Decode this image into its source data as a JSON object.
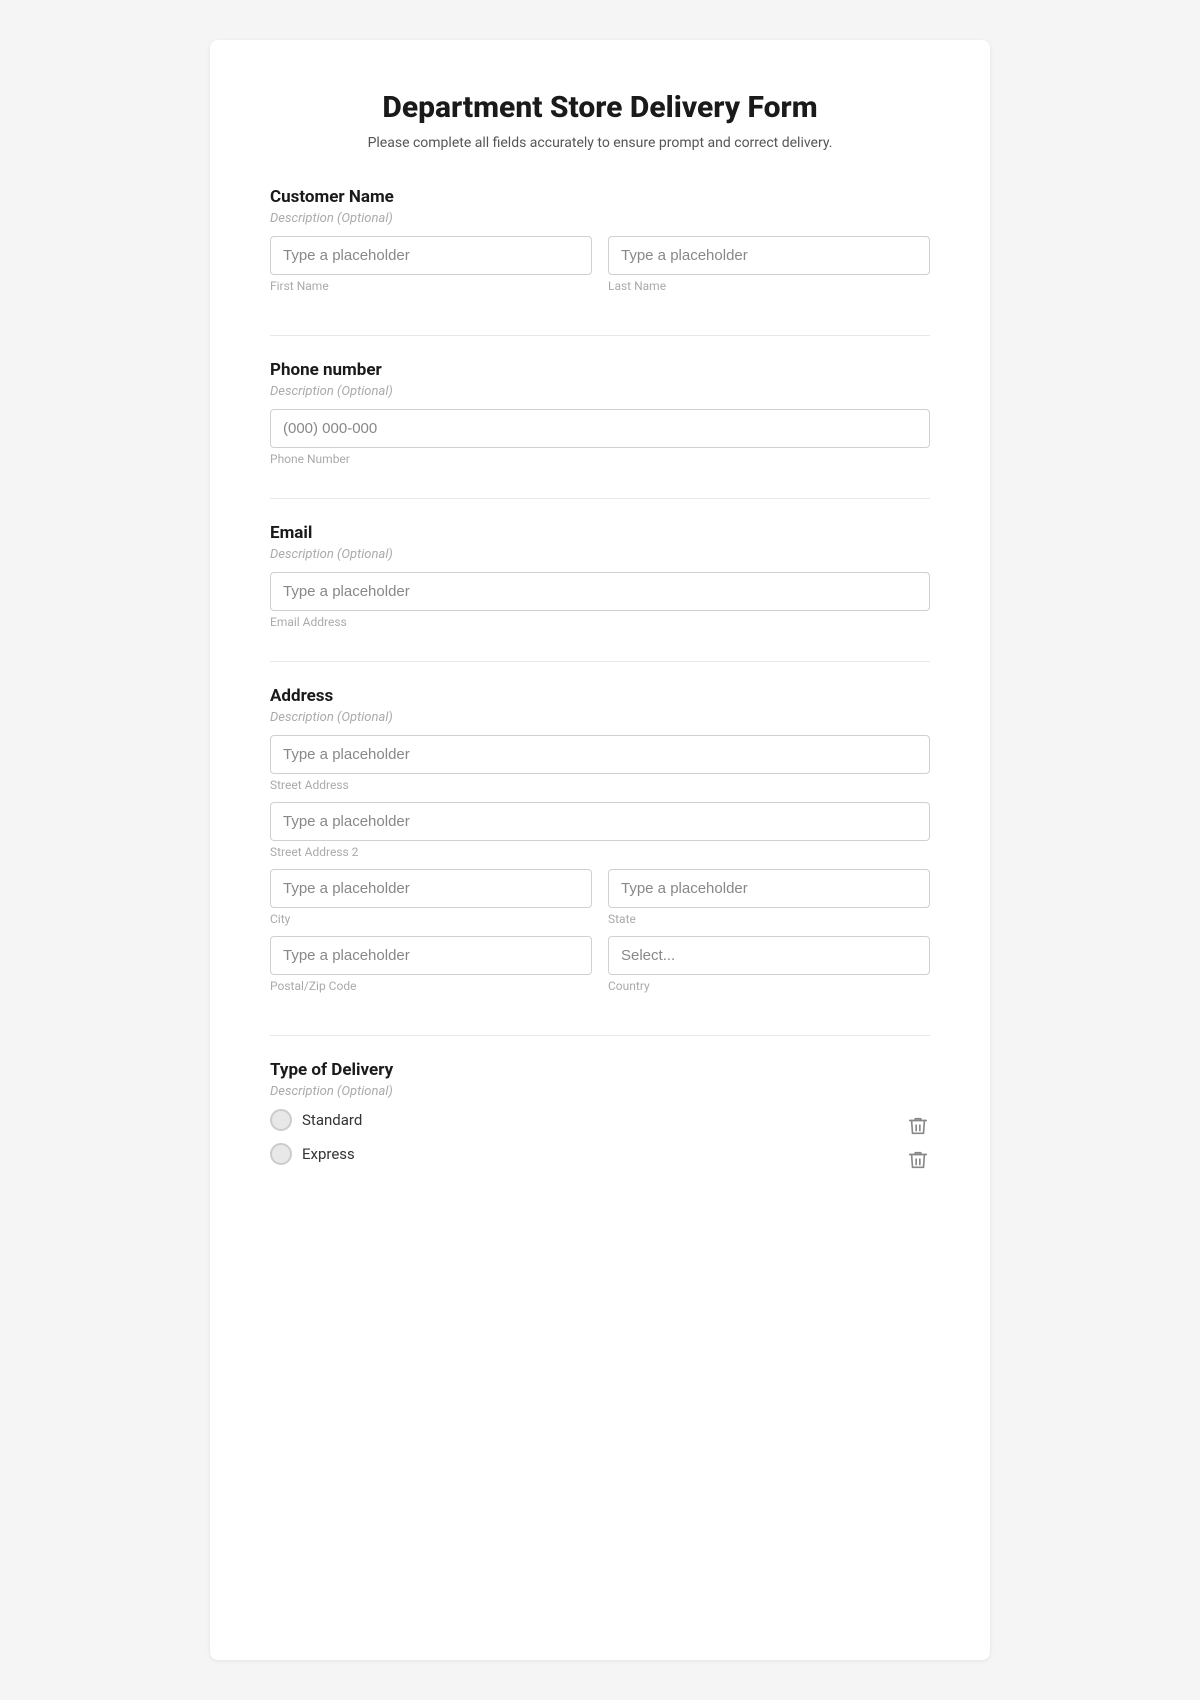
{
  "form": {
    "title": "Department Store Delivery Form",
    "subtitle": "Please complete all fields accurately to ensure prompt and correct delivery.",
    "sections": [
      {
        "id": "customer-name",
        "label": "Customer Name",
        "description": "Description (Optional)",
        "fields": [
          {
            "type": "text",
            "placeholder": "Type a placeholder",
            "sublabel": "First Name"
          },
          {
            "type": "text",
            "placeholder": "Type a placeholder",
            "sublabel": "Last Name"
          }
        ],
        "layout": "two-col"
      },
      {
        "id": "phone-number",
        "label": "Phone number",
        "description": "Description (Optional)",
        "fields": [
          {
            "type": "text",
            "placeholder": "(000) 000-000",
            "sublabel": "Phone Number"
          }
        ],
        "layout": "one-col"
      },
      {
        "id": "email",
        "label": "Email",
        "description": "Description (Optional)",
        "fields": [
          {
            "type": "text",
            "placeholder": "Type a placeholder",
            "sublabel": "Email Address"
          }
        ],
        "layout": "one-col"
      },
      {
        "id": "address",
        "label": "Address",
        "description": "Description (Optional)",
        "rows": [
          {
            "layout": "one-col",
            "fields": [
              {
                "type": "text",
                "placeholder": "Type a placeholder",
                "sublabel": "Street Address"
              }
            ]
          },
          {
            "layout": "one-col",
            "fields": [
              {
                "type": "text",
                "placeholder": "Type a placeholder",
                "sublabel": "Street Address 2"
              }
            ]
          },
          {
            "layout": "two-col",
            "fields": [
              {
                "type": "text",
                "placeholder": "Type a placeholder",
                "sublabel": "City"
              },
              {
                "type": "text",
                "placeholder": "Type a placeholder",
                "sublabel": "State"
              }
            ]
          },
          {
            "layout": "two-col",
            "fields": [
              {
                "type": "text",
                "placeholder": "Type a placeholder",
                "sublabel": "Postal/Zip Code"
              },
              {
                "type": "select",
                "placeholder": "Select...",
                "sublabel": "Country"
              }
            ]
          }
        ]
      },
      {
        "id": "type-of-delivery",
        "label": "Type of Delivery",
        "description": "Description (Optional)",
        "options": [
          {
            "label": "Standard"
          },
          {
            "label": "Express"
          }
        ]
      }
    ]
  }
}
